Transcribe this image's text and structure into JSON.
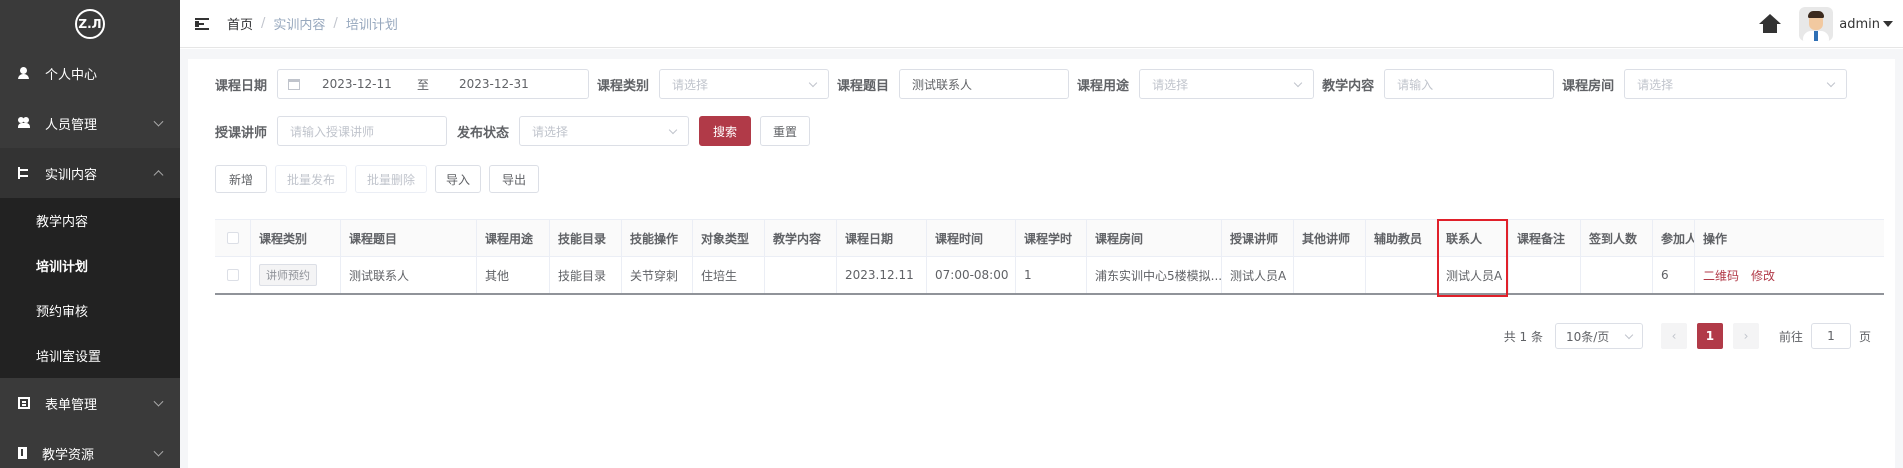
{
  "logo": {
    "text": "Z.Л"
  },
  "sidebar": {
    "items": [
      {
        "label": "个人中心"
      },
      {
        "label": "人员管理"
      },
      {
        "label": "实训内容"
      },
      {
        "label": "表单管理"
      },
      {
        "label": "教学资源"
      }
    ],
    "sub": [
      {
        "label": "教学内容"
      },
      {
        "label": "培训计划"
      },
      {
        "label": "预约审核"
      },
      {
        "label": "培训室设置"
      }
    ]
  },
  "breadcrumb": {
    "home": "首页",
    "level1": "实训内容",
    "level2": "培训计划",
    "sep": "/"
  },
  "user": {
    "name": "admin"
  },
  "filters": {
    "date_label": "课程日期",
    "date_start": "2023-12-11",
    "date_to": "至",
    "date_end": "2023-12-31",
    "type_label": "课程类别",
    "type_placeholder": "请选择",
    "topic_label": "课程题目",
    "topic_value": "测试联系人",
    "use_label": "课程用途",
    "use_placeholder": "请选择",
    "content_label": "教学内容",
    "content_placeholder": "请输入",
    "room_label": "课程房间",
    "room_placeholder": "请选择",
    "teacher_label": "授课讲师",
    "teacher_placeholder": "请输入授课讲师",
    "status_label": "发布状态",
    "status_placeholder": "请选择",
    "search_btn": "搜索",
    "reset_btn": "重置"
  },
  "toolbar": {
    "add": "新增",
    "batch_publish": "批量发布",
    "batch_delete": "批量删除",
    "import": "导入",
    "export": "导出"
  },
  "table": {
    "headers": [
      "课程类别",
      "课程题目",
      "课程用途",
      "技能目录",
      "技能操作",
      "对象类型",
      "教学内容",
      "课程日期",
      "课程时间",
      "课程学时",
      "课程房间",
      "授课讲师",
      "其他讲师",
      "辅助教员",
      "联系人",
      "课程备注",
      "签到人数",
      "参加人",
      "操作"
    ],
    "rows": [
      {
        "tag": "讲师预约",
        "cells": [
          "测试联系人",
          "其他",
          "技能目录",
          "关节穿刺",
          "住培生",
          "",
          "2023.12.11",
          "07:00-08:00",
          "1",
          "浦东实训中心5楼模拟...",
          "测试人员A",
          "",
          "",
          "测试人员A",
          "",
          "",
          "6"
        ],
        "actions": [
          "二维码",
          "修改"
        ]
      }
    ]
  },
  "pagination": {
    "total": "共 1 条",
    "page_size": "10条/页",
    "current": "1",
    "goto_label": "前往",
    "goto_value": "1",
    "page_suffix": "页",
    "prev": "‹",
    "next": "›"
  },
  "colors": {
    "accent": "#b13a48",
    "sidebar": "#3a3a3a",
    "highlight": "#e0202a"
  }
}
